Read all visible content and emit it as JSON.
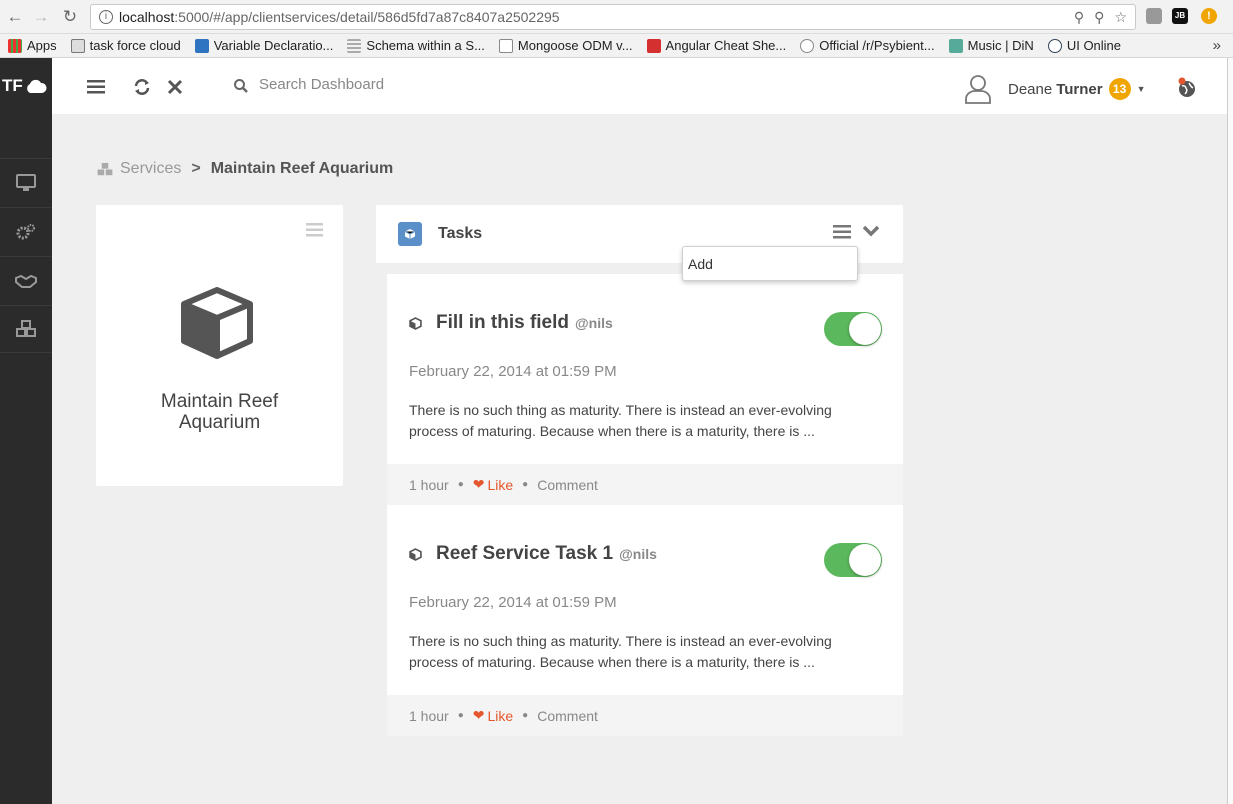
{
  "browser": {
    "url_host": "localhost",
    "url_path": ":5000/#/app/clientservices/detail/586d5fd7a87c8407a2502295",
    "bookmarks": [
      {
        "label": "Apps"
      },
      {
        "label": "task force cloud"
      },
      {
        "label": "Variable Declaratio..."
      },
      {
        "label": "Schema within a S..."
      },
      {
        "label": "Mongoose ODM v..."
      },
      {
        "label": "Angular Cheat She..."
      },
      {
        "label": "Official /r/Psybient..."
      },
      {
        "label": "Music | DiN"
      },
      {
        "label": "UI Online"
      }
    ],
    "more_label": "»"
  },
  "app": {
    "brand": "TF",
    "search_placeholder": "Search Dashboard",
    "user_first": "Deane",
    "user_last": "Turner",
    "notification_count": "13"
  },
  "breadcrumb": {
    "parent": "Services",
    "separator": ">",
    "current": "Maintain Reef Aquarium"
  },
  "service": {
    "title_line1": "Maintain Reef",
    "title_line2": "Aquarium"
  },
  "tasks": {
    "title": "Tasks",
    "menu_item": "Add",
    "items": [
      {
        "title": "Fill in this field",
        "user": "@nils",
        "date": "February 22, 2014 at 01:59 PM",
        "desc_line1": "There is no such thing as maturity. There is instead an ever-evolving",
        "desc_line2": "process of maturing. Because when there is a maturity, there is ...",
        "time": "1 hour",
        "like": "Like",
        "comment": "Comment",
        "enabled": true
      },
      {
        "title": "Reef Service Task 1",
        "user": "@nils",
        "date": "February 22, 2014 at 01:59 PM",
        "desc_line1": "There is no such thing as maturity. There is instead an ever-evolving",
        "desc_line2": "process of maturing. Because when there is a maturity, there is ...",
        "time": "1 hour",
        "like": "Like",
        "comment": "Comment",
        "enabled": true
      }
    ]
  },
  "colors": {
    "toggle_on": "#5cb85c",
    "like": "#e4572e",
    "badge": "#f0a500",
    "sidebar": "#2b2b2b",
    "task_icon_bg": "#5b8fc7"
  }
}
